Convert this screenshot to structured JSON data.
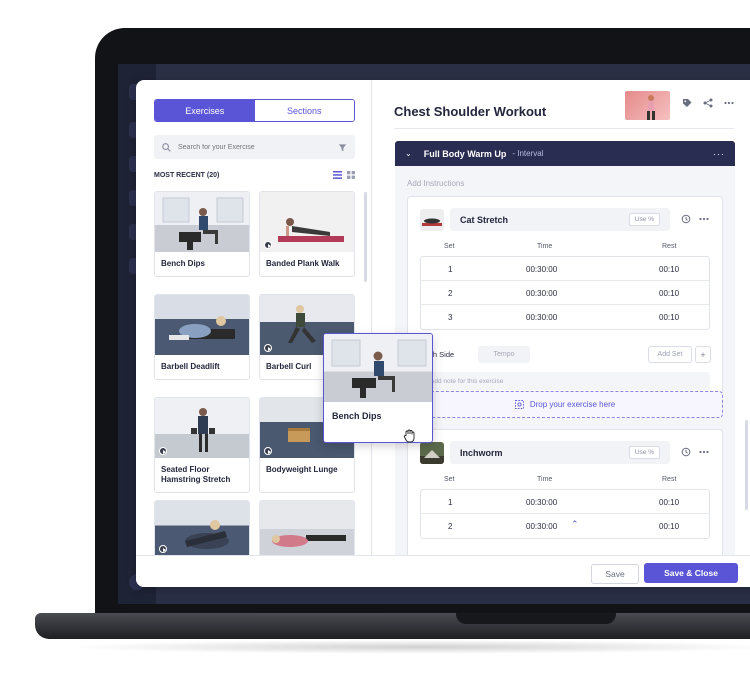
{
  "left_panel": {
    "tabs": [
      {
        "label": "Exercises",
        "active": true
      },
      {
        "label": "Sections",
        "active": false
      }
    ],
    "search": {
      "placeholder": "Search for your Exercise"
    },
    "recent_label": "MOST RECENT (20)",
    "exercises": [
      {
        "name": "Bench Dips",
        "video": false
      },
      {
        "name": "Banded Plank Walk",
        "video": true
      },
      {
        "name": "Barbell Deadlift",
        "video": false
      },
      {
        "name": "Barbell Curl",
        "video": true
      },
      {
        "name": "Seated Floor Hamstring Stretch",
        "video": true
      },
      {
        "name": "Bodyweight Lunge",
        "video": true
      },
      {
        "name": "",
        "video": true
      },
      {
        "name": "",
        "video": false
      }
    ]
  },
  "workout": {
    "title": "Chest Shoulder Workout",
    "block": {
      "name": "Full Body Warm Up",
      "type": "- Interval"
    },
    "add_instructions": "Add Instructions",
    "columns": {
      "set": "Set",
      "time": "Time",
      "rest": "Rest"
    },
    "exercises": [
      {
        "name": "Cat Stretch",
        "use_pct": "Use %",
        "rows": [
          {
            "set": "1",
            "time": "00:30:00",
            "rest": "00:10"
          },
          {
            "set": "2",
            "time": "00:30:00",
            "rest": "00:10"
          },
          {
            "set": "3",
            "time": "00:30:00",
            "rest": "00:10"
          }
        ],
        "each_side": "Each Side",
        "tempo_placeholder": "Tempo",
        "add_set": "Add Set",
        "note_placeholder": "Add note for this exercise"
      },
      {
        "name": "Inchworm",
        "use_pct": "Use %",
        "rows": [
          {
            "set": "1",
            "time": "00:30:00",
            "rest": "00:10"
          },
          {
            "set": "2",
            "time": "00:30:00",
            "rest": "00:10"
          }
        ]
      }
    ],
    "drop_zone": "Drop your exercise here"
  },
  "footer": {
    "save": "Save",
    "save_close": "Save & Close"
  },
  "dragging": {
    "name": "Bench Dips"
  },
  "colors": {
    "accent": "#5a55d6",
    "block_header": "#2a2d52",
    "text": "#23263d"
  }
}
